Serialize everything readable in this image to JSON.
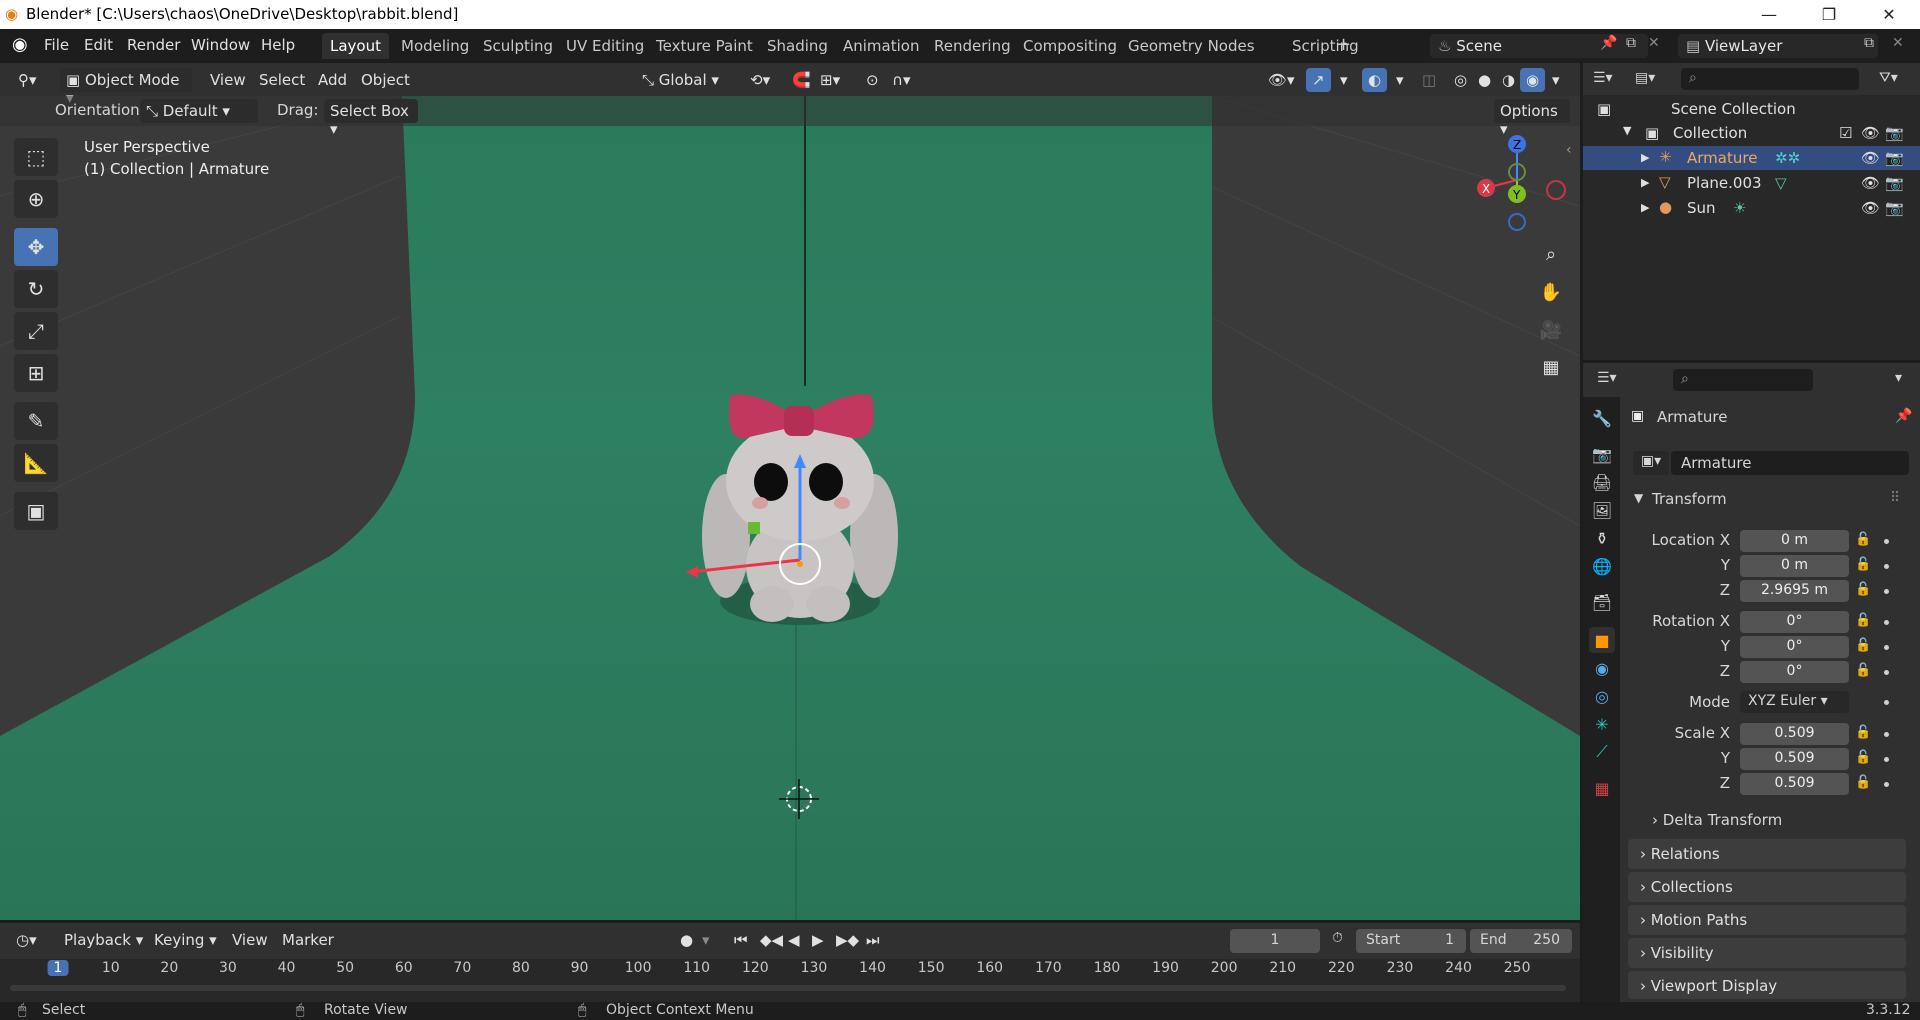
{
  "window": {
    "title": "Blender* [C:\\Users\\chaos\\OneDrive\\Desktop\\rabbit.blend]"
  },
  "menu": [
    "File",
    "Edit",
    "Render",
    "Window",
    "Help"
  ],
  "workspaces": [
    "Layout",
    "Modeling",
    "Sculpting",
    "UV Editing",
    "Texture Paint",
    "Shading",
    "Animation",
    "Rendering",
    "Compositing",
    "Geometry Nodes",
    "Scripting"
  ],
  "active_workspace": "Layout",
  "scene_name": "Scene",
  "view_layer": "ViewLayer",
  "viewport_header": {
    "mode": "Object Mode",
    "menus": [
      "View",
      "Select",
      "Add",
      "Object"
    ],
    "transform_orientation": "Global"
  },
  "tool_settings": {
    "orientation_label": "Orientation:",
    "orientation_value": "Default",
    "drag_label": "Drag:",
    "drag_value": "Select Box",
    "options_label": "Options"
  },
  "viewport": {
    "view_name": "User Perspective",
    "context": "(1) Collection | Armature",
    "background_color": "#2a7558",
    "gizmo_axes": [
      "X",
      "Y",
      "Z"
    ]
  },
  "toolbar_icons": [
    "select-box-icon",
    "cursor-icon",
    "move-icon",
    "rotate-icon",
    "scale-icon",
    "transform-icon",
    "annotate-icon",
    "measure-icon",
    "add-cube-icon"
  ],
  "outliner": {
    "root": "Scene Collection",
    "collection": "Collection",
    "items": [
      {
        "name": "Armature",
        "selected": true
      },
      {
        "name": "Plane.003",
        "selected": false
      },
      {
        "name": "Sun",
        "selected": false
      }
    ]
  },
  "properties": {
    "object_name": "Armature",
    "datablock_name": "Armature",
    "transform_label": "Transform",
    "location_label": "Location X",
    "rotation_label": "Rotation X",
    "scale_label": "Scale X",
    "axis_y": "Y",
    "axis_z": "Z",
    "location": [
      "0 m",
      "0 m",
      "2.9695 m"
    ],
    "rotation": [
      "0°",
      "0°",
      "0°"
    ],
    "mode_label": "Mode",
    "mode_value": "XYZ Euler",
    "scale": [
      "0.509",
      "0.509",
      "0.509"
    ],
    "subpanels": [
      "Delta Transform",
      "Relations",
      "Collections",
      "Motion Paths",
      "Visibility",
      "Viewport Display"
    ]
  },
  "timeline": {
    "menus": [
      "Playback",
      "Keying",
      "View",
      "Marker"
    ],
    "current_frame": "1",
    "start_label": "Start",
    "start": "1",
    "end_label": "End",
    "end": "250",
    "ticks": [
      "1",
      "10",
      "20",
      "30",
      "40",
      "50",
      "60",
      "70",
      "80",
      "90",
      "100",
      "110",
      "120",
      "130",
      "140",
      "150",
      "160",
      "170",
      "180",
      "190",
      "200",
      "210",
      "220",
      "230",
      "240",
      "250"
    ]
  },
  "status_bar": {
    "hint1": "Select",
    "hint2": "Rotate View",
    "hint3": "Object Context Menu",
    "version": "3.3.12"
  }
}
